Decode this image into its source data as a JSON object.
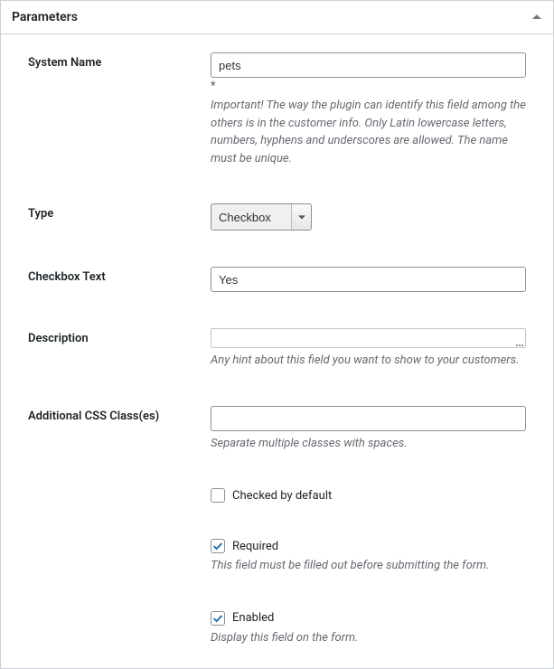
{
  "panel": {
    "title": "Parameters"
  },
  "fields": {
    "system_name": {
      "label": "System Name",
      "value": "pets",
      "required_mark": "*",
      "hint": "Important! The way the plugin can identify this field among the others is in the customer info. Only Latin lowercase letters, numbers, hyphens and underscores are allowed. The name must be unique."
    },
    "type": {
      "label": "Type",
      "value": "Checkbox"
    },
    "checkbox_text": {
      "label": "Checkbox Text",
      "value": "Yes"
    },
    "description": {
      "label": "Description",
      "value": "",
      "hint": "Any hint about this field you want to show to your customers."
    },
    "css_classes": {
      "label": "Additional CSS Class(es)",
      "value": "",
      "hint": "Separate multiple classes with spaces."
    },
    "checked_default": {
      "label": "Checked by default",
      "checked": false
    },
    "required": {
      "label": "Required",
      "checked": true,
      "hint": "This field must be filled out before submitting the form."
    },
    "enabled": {
      "label": "Enabled",
      "checked": true,
      "hint": "Display this field on the form."
    }
  }
}
